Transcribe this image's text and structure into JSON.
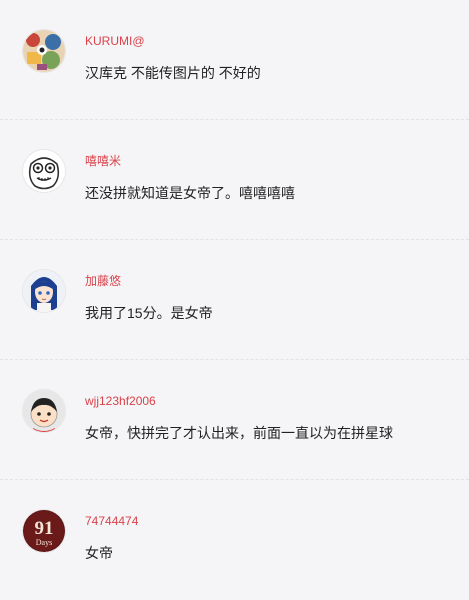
{
  "comments": [
    {
      "username": "KURUMI@",
      "text": "汉库克 不能传图片的 不好的",
      "avatar": "colorful-illustration-avatar-icon"
    },
    {
      "username": "嘻嘻米",
      "text": "还没拼就知道是女帝了。嘻嘻嘻嘻",
      "avatar": "cartoon-face-avatar-icon"
    },
    {
      "username": "加藤悠",
      "text": "我用了15分。是女帝",
      "avatar": "anime-girl-avatar-icon"
    },
    {
      "username": "wjj123hf2006",
      "text": "女帝，快拼完了才认出来，前面一直以为在拼星球",
      "avatar": "boy-cartoon-avatar-icon"
    },
    {
      "username": "74744474",
      "text": "女帝",
      "avatar": "91-days-avatar-icon",
      "avatar_text": {
        "line1": "91",
        "line2": "Days"
      }
    }
  ],
  "colors": {
    "username": "#d9424a",
    "text": "#222222",
    "background": "#f5f5f7",
    "divider": "#e3e3e3"
  }
}
